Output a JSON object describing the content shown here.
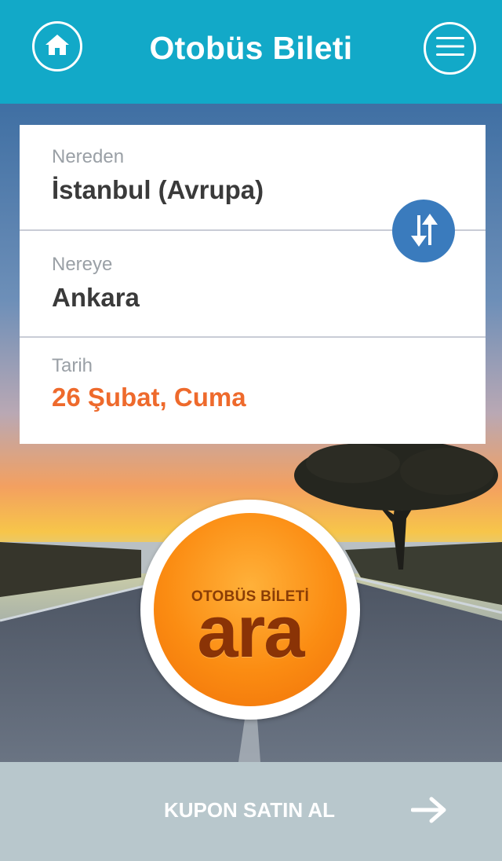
{
  "header": {
    "title": "Otobüs Bileti",
    "home_icon": "home-icon",
    "menu_icon": "hamburger-menu-icon",
    "bg_color": "#12a9c8"
  },
  "form": {
    "from_label": "Nereden",
    "from_value": "İstanbul (Avrupa)",
    "to_label": "Nereye",
    "to_value": "Ankara",
    "date_label": "Tarih",
    "date_value": "26 Şubat, Cuma",
    "date_color": "#ee6a2c",
    "swap_icon": "swap-arrows-icon"
  },
  "search_button": {
    "top_text": "OTOBÜS BİLETİ",
    "big_text": "ara"
  },
  "footer": {
    "label": "KUPON SATIN AL",
    "arrow_icon": "arrow-right-icon",
    "bg_color": "#b8c7cc"
  }
}
